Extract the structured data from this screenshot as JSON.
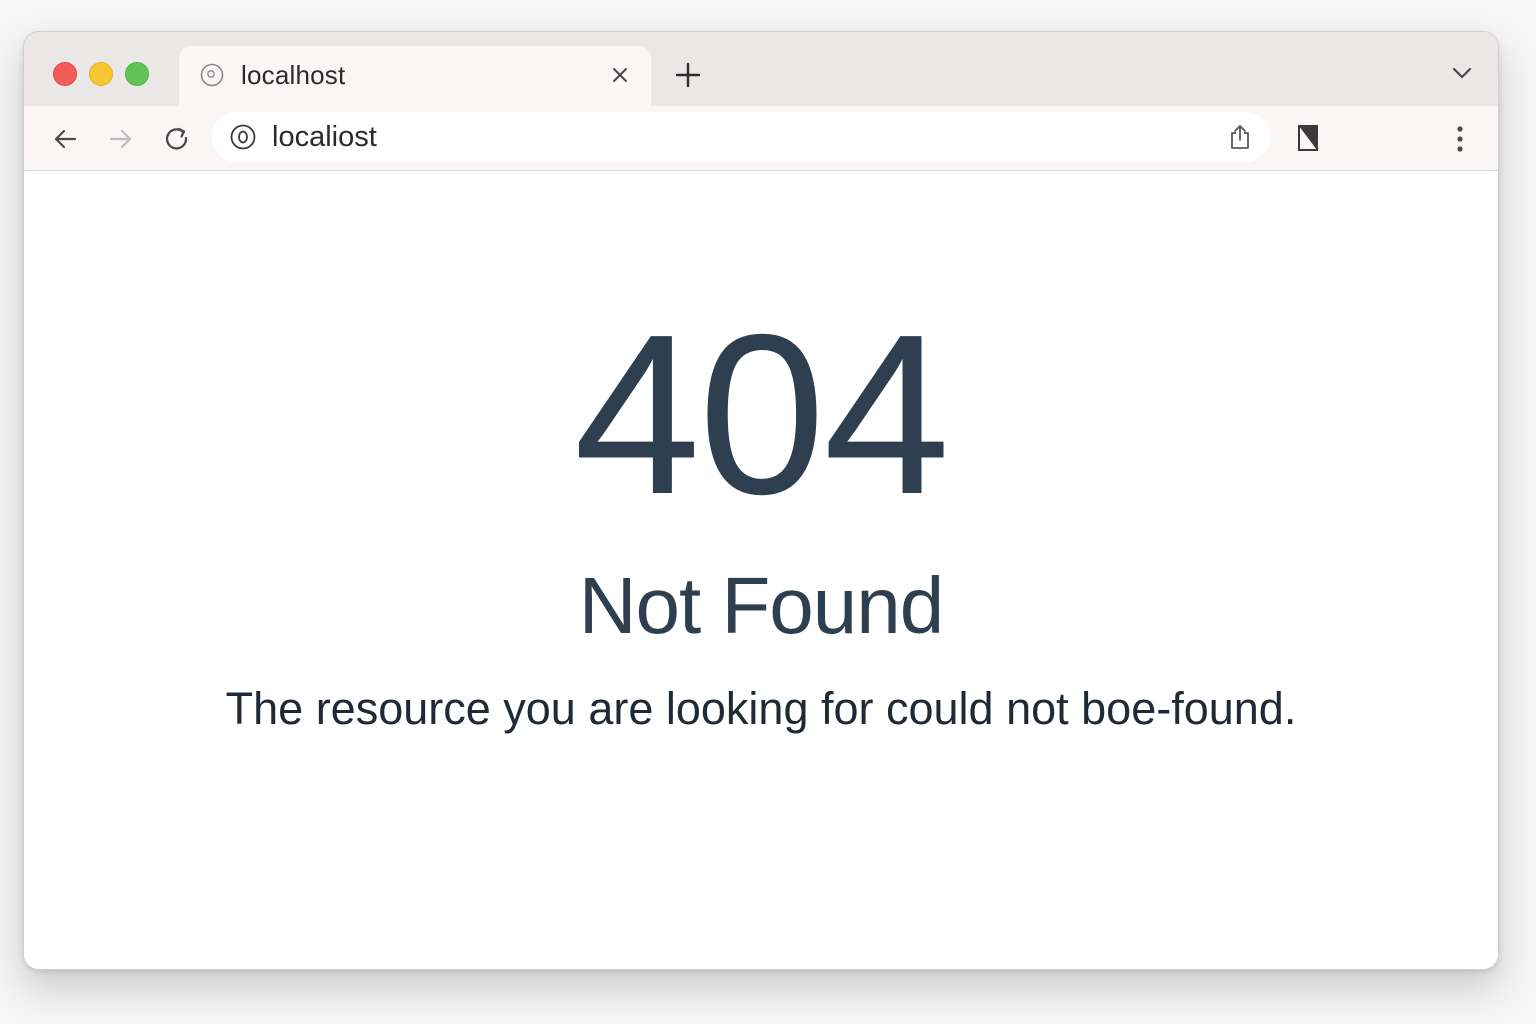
{
  "browser": {
    "tab": {
      "title": "localhost",
      "favicon": "globe-icon"
    },
    "new_tab_icon": "plus-icon",
    "tab_menu_icon": "chevron-down-icon",
    "address_bar": {
      "url": "localiost",
      "site_icon": "site-info-icon"
    },
    "nav_icons": [
      "back-arrow-icon",
      "forward-arrow-icon",
      "reload-icon"
    ],
    "toolbar_icons": [
      "share-icon",
      "reader-mode-icon",
      "more-menu-icon"
    ],
    "colors": {
      "traffic_red": "#f25c54",
      "traffic_yellow": "#f6c532",
      "traffic_green": "#5fc454"
    }
  },
  "page": {
    "code": "404",
    "title": "Not Found",
    "message": "The resource you are looking for could not boe-found.",
    "text_color": "#2e3f50"
  }
}
